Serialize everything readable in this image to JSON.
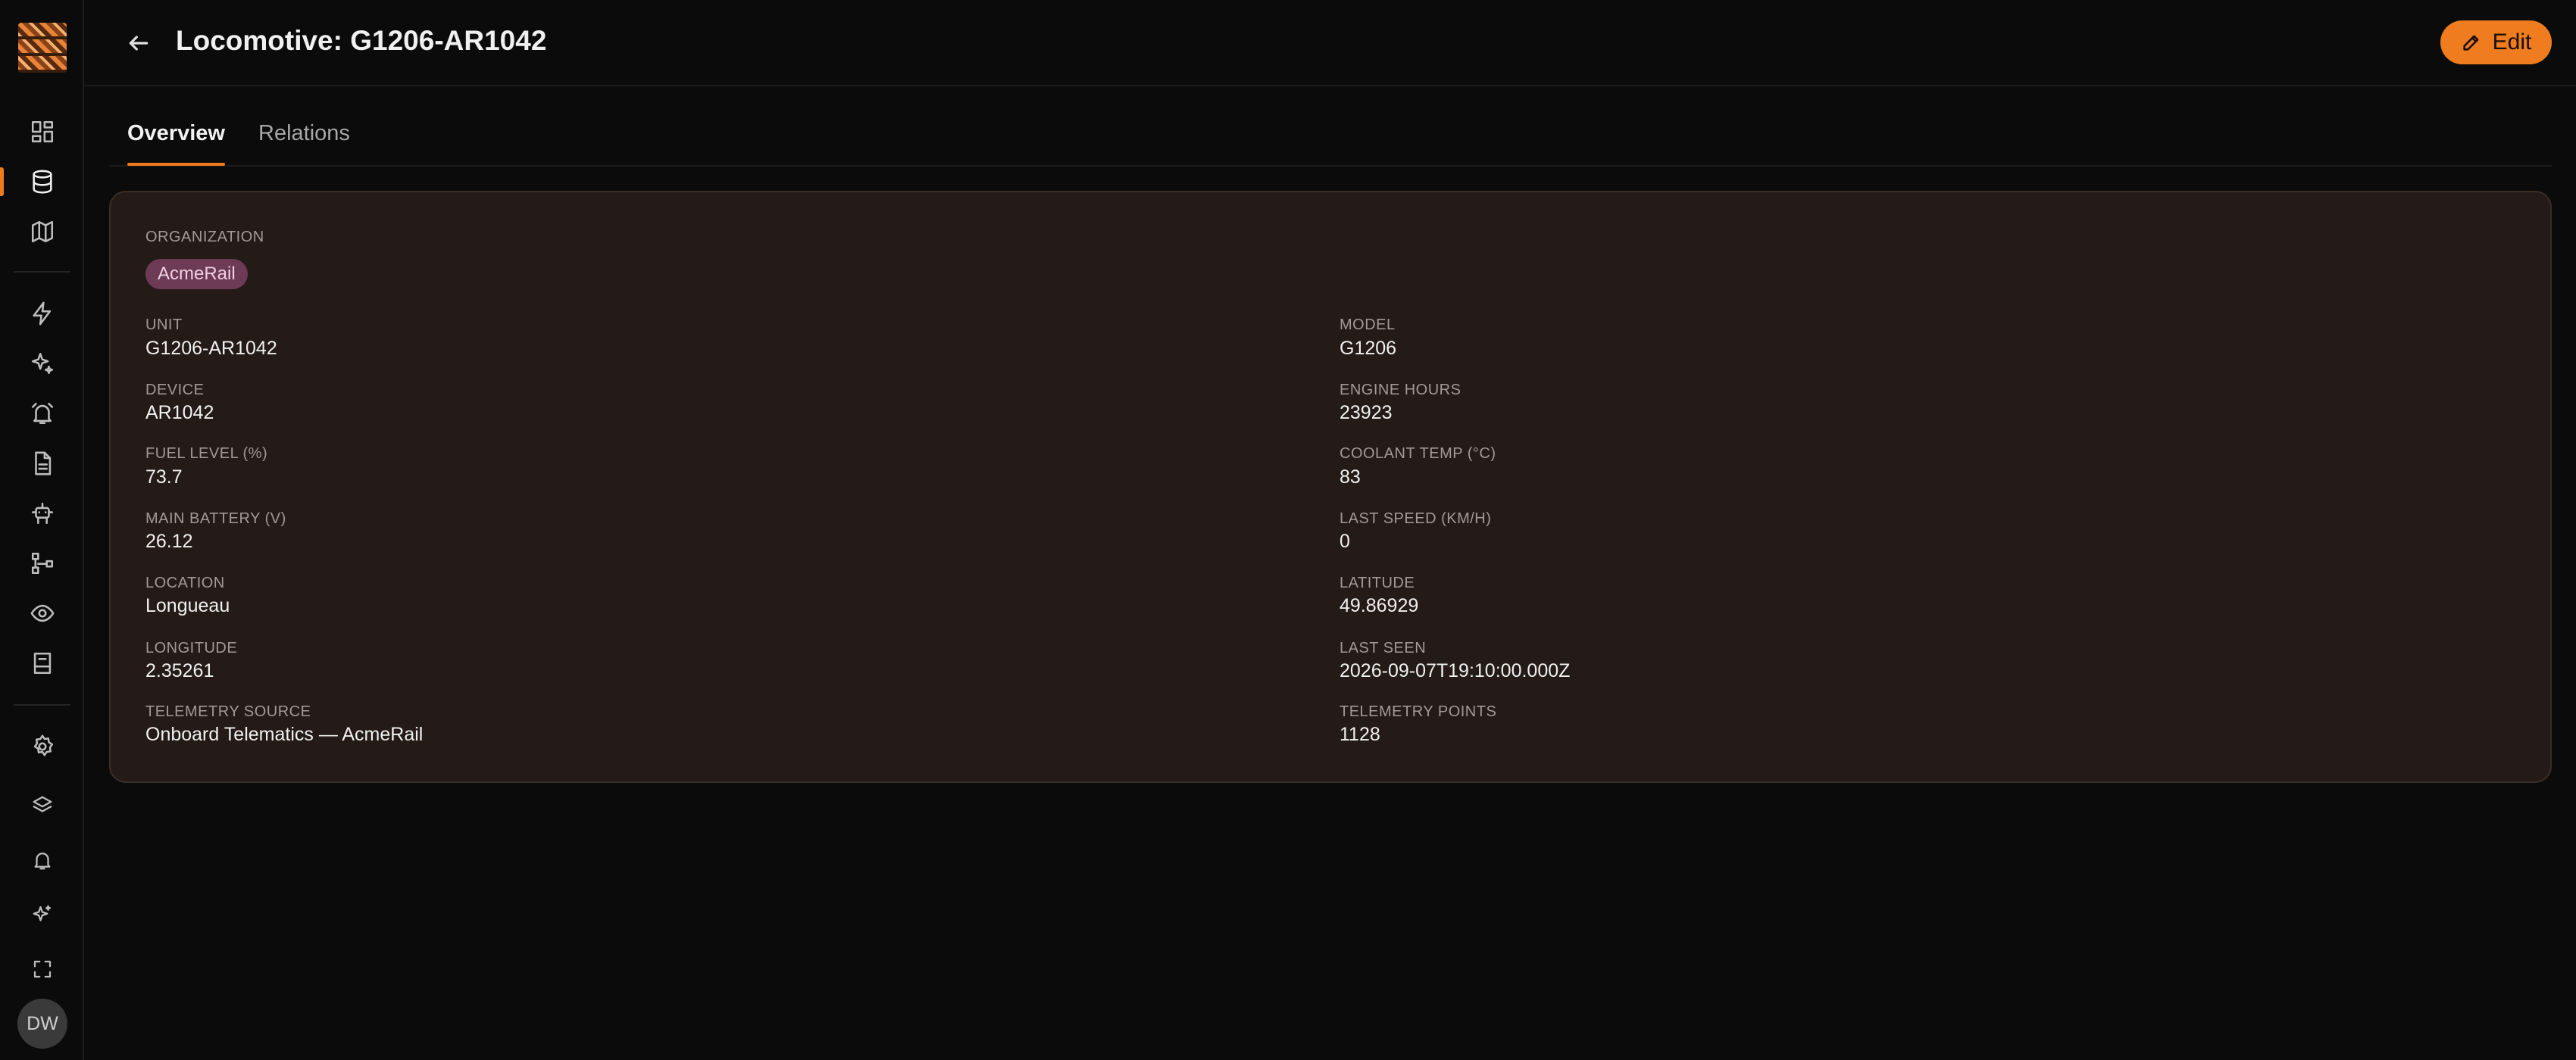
{
  "header": {
    "title": "Locomotive: G1206-AR1042",
    "edit_label": "Edit"
  },
  "tabs": [
    {
      "label": "Overview",
      "active": true
    },
    {
      "label": "Relations",
      "active": false
    }
  ],
  "user": {
    "initials": "DW"
  },
  "sidebar": {
    "items": [
      {
        "icon": "dashboard-icon"
      },
      {
        "icon": "database-icon",
        "active": true
      },
      {
        "icon": "map-icon"
      },
      {
        "icon": "bolt-icon"
      },
      {
        "icon": "sparkles-icon"
      },
      {
        "icon": "alarm-icon"
      },
      {
        "icon": "document-icon"
      },
      {
        "icon": "robot-icon"
      },
      {
        "icon": "flow-icon"
      },
      {
        "icon": "eye-icon"
      },
      {
        "icon": "report-icon"
      },
      {
        "icon": "gear-icon"
      },
      {
        "icon": "layers-icon"
      },
      {
        "icon": "bell-icon"
      },
      {
        "icon": "sparkle-icon"
      },
      {
        "icon": "fullscreen-icon"
      }
    ]
  },
  "organization": {
    "label": "ORGANIZATION",
    "value": "AcmeRail"
  },
  "fields_left": [
    {
      "label": "UNIT",
      "value": "G1206-AR1042"
    },
    {
      "label": "DEVICE",
      "value": "AR1042"
    },
    {
      "label": "FUEL LEVEL (%)",
      "value": "73.7"
    },
    {
      "label": "MAIN BATTERY (V)",
      "value": "26.12"
    },
    {
      "label": "LOCATION",
      "value": "Longueau"
    },
    {
      "label": "LONGITUDE",
      "value": "2.35261"
    },
    {
      "label": "TELEMETRY SOURCE",
      "value": "Onboard Telematics — AcmeRail"
    }
  ],
  "fields_right": [
    {
      "label": "MODEL",
      "value": "G1206"
    },
    {
      "label": "ENGINE HOURS",
      "value": "23923"
    },
    {
      "label": "COOLANT TEMP (°C)",
      "value": "83"
    },
    {
      "label": "LAST SPEED (KM/H)",
      "value": "0"
    },
    {
      "label": "LATITUDE",
      "value": "49.86929"
    },
    {
      "label": "LAST SEEN",
      "value": "2026-09-07T19:10:00.000Z"
    },
    {
      "label": "TELEMETRY POINTS",
      "value": "1128"
    }
  ],
  "colors": {
    "accent": "#ee7a1f",
    "background": "#0b0b0b",
    "card": "#241a17",
    "chip": "#6e3b56"
  }
}
